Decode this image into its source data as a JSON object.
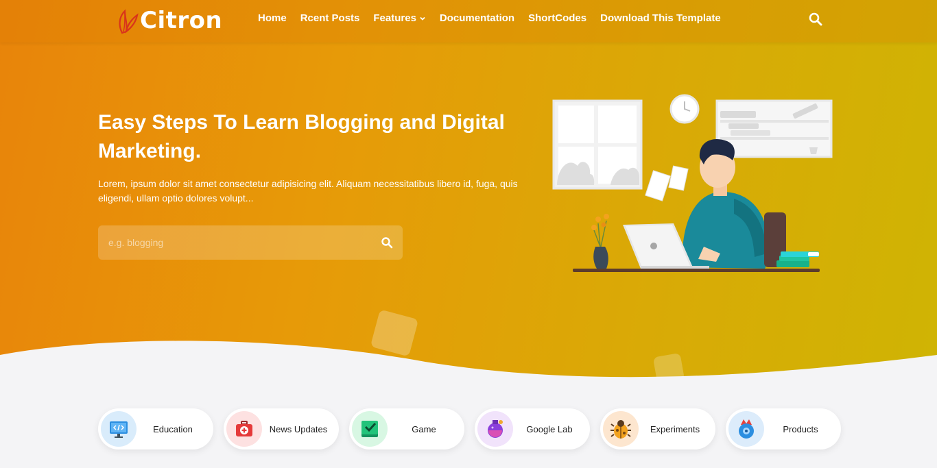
{
  "brand": {
    "name": "itron",
    "logo_letter": "C"
  },
  "nav": {
    "items": [
      {
        "label": "Home"
      },
      {
        "label": "Rcent Posts"
      },
      {
        "label": "Features"
      },
      {
        "label": "Documentation"
      },
      {
        "label": "ShortCodes"
      },
      {
        "label": "Download This Template"
      }
    ],
    "search_icon": "search-icon"
  },
  "hero": {
    "title": "Easy Steps To Learn Blogging and Digital Marketing.",
    "description": "Lorem, ipsum dolor sit amet consectetur adipisicing elit. Aliquam necessitatibus libero id, fuga, quis eligendi, ullam optio dolores volupt...",
    "search_placeholder": "e.g. blogging",
    "search_icon": "search-icon"
  },
  "categories": [
    {
      "label": "Education",
      "icon": "monitor-code-icon",
      "color": "#d9ecfb"
    },
    {
      "label": "News Updates",
      "icon": "first-aid-kit-icon",
      "color": "#fde1e1"
    },
    {
      "label": "Game",
      "icon": "checkbox-icon",
      "color": "#d8f7e3"
    },
    {
      "label": "Google Lab",
      "icon": "flask-icon",
      "color": "#f1e3fb"
    },
    {
      "label": "Experiments",
      "icon": "bug-icon",
      "color": "#fde6cf"
    },
    {
      "label": "Products",
      "icon": "rocket-disc-icon",
      "color": "#dcecfb"
    }
  ],
  "colors": {
    "accent": "#e8840a",
    "hero_end": "#cfb404",
    "white": "#ffffff"
  }
}
